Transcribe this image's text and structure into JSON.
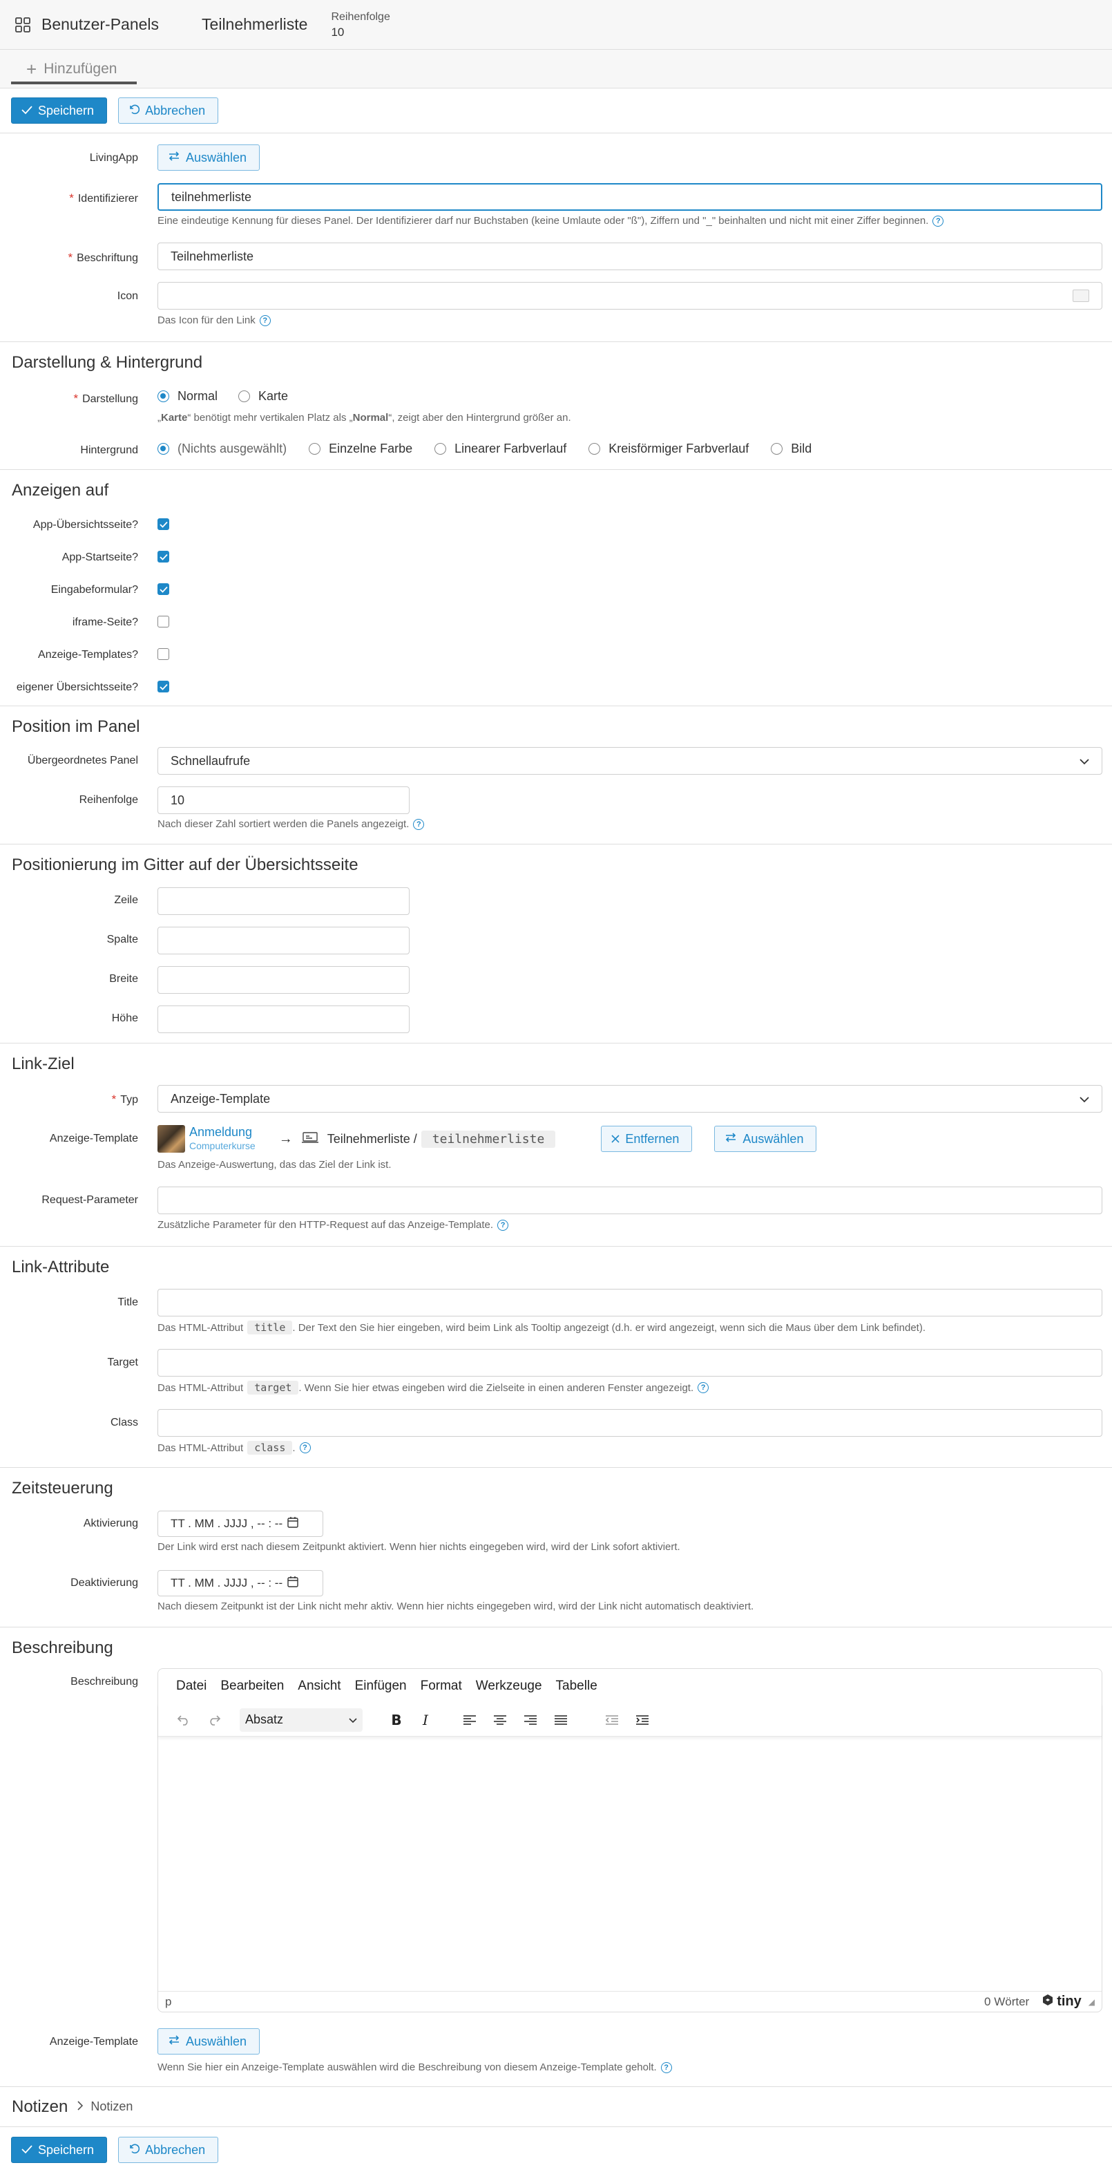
{
  "header": {
    "title": "Benutzer-Panels",
    "subtitle": "Teilnehmerliste",
    "meta_label": "Reihenfolge",
    "meta_value": "10"
  },
  "tabs": {
    "add_label": "Hinzufügen"
  },
  "actions": {
    "save": "Speichern",
    "cancel": "Abbrechen"
  },
  "basic": {
    "livingapp_label": "LivingApp",
    "select_button": "Auswählen",
    "identifier_label": "Identifizierer",
    "identifier_value": "teilnehmerliste",
    "identifier_help": "Eine eindeutige Kennung für dieses Panel. Der Identifizierer darf nur Buchstaben (keine Umlaute oder \"ß\"), Ziffern und \"_\" beinhalten und nicht mit einer Ziffer beginnen.",
    "caption_label": "Beschriftung",
    "caption_value": "Teilnehmerliste",
    "icon_label": "Icon",
    "icon_help": "Das Icon für den Link"
  },
  "appearance": {
    "title": "Darstellung & Hintergrund",
    "display_label": "Darstellung",
    "display_options": [
      "Normal",
      "Karte"
    ],
    "display_selected": "Normal",
    "display_help_1": "„",
    "display_help_karte": "Karte",
    "display_help_2": "“ benötigt mehr vertikalen Platz als „",
    "display_help_normal": "Normal",
    "display_help_3": "“, zeigt aber den Hintergrund größer an.",
    "background_label": "Hintergrund",
    "background_options": [
      "(Nichts ausgewählt)",
      "Einzelne Farbe",
      "Linearer Farbverlauf",
      "Kreisförmiger Farbverlauf",
      "Bild"
    ],
    "background_selected": "(Nichts ausgewählt)"
  },
  "show_on": {
    "title": "Anzeigen auf",
    "items": [
      {
        "label": "App-Übersichtsseite?",
        "checked": true
      },
      {
        "label": "App-Startseite?",
        "checked": true
      },
      {
        "label": "Eingabeformular?",
        "checked": true
      },
      {
        "label": "iframe-Seite?",
        "checked": false
      },
      {
        "label": "Anzeige-Templates?",
        "checked": false
      },
      {
        "label": "eigener Übersichtsseite?",
        "checked": true
      }
    ]
  },
  "position": {
    "title": "Position im Panel",
    "parent_label": "Übergeordnetes Panel",
    "parent_value": "Schnellaufrufe",
    "order_label": "Reihenfolge",
    "order_value": "10",
    "order_help": "Nach dieser Zahl sortiert werden die Panels angezeigt."
  },
  "grid": {
    "title": "Positionierung im Gitter auf der Übersichtsseite",
    "row_label": "Zeile",
    "col_label": "Spalte",
    "width_label": "Breite",
    "height_label": "Höhe"
  },
  "link_target": {
    "title": "Link-Ziel",
    "type_label": "Typ",
    "type_value": "Anzeige-Template",
    "template_label": "Anzeige-Template",
    "app_name": "Anmeldung",
    "app_sub": "Computerkurse",
    "template_name": "Teilnehmerliste /",
    "template_code": "teilnehmerliste",
    "remove_button": "Entfernen",
    "select_button": "Auswählen",
    "template_help": "Das Anzeige-Auswertung, das das Ziel der Link ist.",
    "request_label": "Request-Parameter",
    "request_help": "Zusätzliche Parameter für den HTTP-Request auf das Anzeige-Template."
  },
  "link_attrs": {
    "title": "Link-Attribute",
    "title_label": "Title",
    "title_help_1": "Das HTML-Attribut",
    "title_code": "title",
    "title_help_2": ". Der Text den Sie hier eingeben, wird beim Link als Tooltip angezeigt (d.h. er wird angezeigt, wenn sich die Maus über dem Link befindet).",
    "target_label": "Target",
    "target_help_1": "Das HTML-Attribut",
    "target_code": "target",
    "target_help_2": ". Wenn Sie hier etwas eingeben wird die Zielseite in einen anderen Fenster angezeigt.",
    "class_label": "Class",
    "class_help_1": "Das HTML-Attribut",
    "class_code": "class",
    "class_help_2": "."
  },
  "timing": {
    "title": "Zeitsteuerung",
    "activate_label": "Aktivierung",
    "activate_placeholder": "TT . MM . JJJJ ,  -- : --",
    "activate_help": "Der Link wird erst nach diesem Zeitpunkt aktiviert. Wenn hier nichts eingegeben wird, wird der Link sofort aktiviert.",
    "deactivate_label": "Deaktivierung",
    "deactivate_placeholder": "TT . MM . JJJJ ,  -- : --",
    "deactivate_help": "Nach diesem Zeitpunkt ist der Link nicht mehr aktiv. Wenn hier nichts eingegeben wird, wird der Link nicht automatisch deaktiviert."
  },
  "description": {
    "title": "Beschreibung",
    "editor_label": "Beschreibung",
    "menu": [
      "Datei",
      "Bearbeiten",
      "Ansicht",
      "Einfügen",
      "Format",
      "Werkzeuge",
      "Tabelle"
    ],
    "block_format": "Absatz",
    "status_path": "p",
    "word_count": "0 Wörter",
    "brand": "tiny",
    "template_label": "Anzeige-Template",
    "template_button": "Auswählen",
    "template_help": "Wenn Sie hier ein Anzeige-Template auswählen wird die Beschreibung von diesem Anzeige-Template geholt."
  },
  "notes": {
    "title": "Notizen",
    "crumb": "Notizen"
  },
  "colors": {
    "accent": "#1e88c8",
    "required": "#d9342b"
  }
}
